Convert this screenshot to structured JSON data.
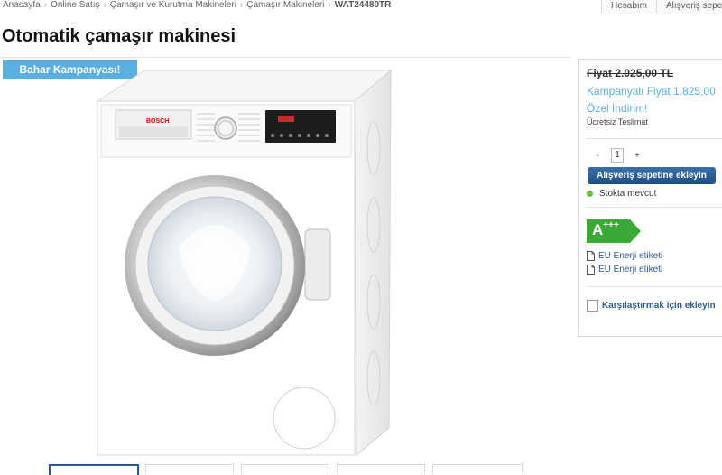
{
  "breadcrumb": {
    "items": [
      "Anasayfa",
      "Online Satış",
      "Çamaşır ve Kurutma Makineleri",
      "Çamaşır Makineleri"
    ],
    "current": "WAT24480TR"
  },
  "top_links": [
    "Hesabım",
    "Alışveriş sepeti"
  ],
  "page": {
    "title": "Otomatik çamaşır makinesi",
    "badge": "Bahar Kampanyası!"
  },
  "product_image": {
    "brand": "BOSCH"
  },
  "sidebar": {
    "old_price": "Fiyat 2.025,00 TL",
    "campaign_price": "Kampanyalı Fiyat 1.825,00",
    "special_discount": "Özel İndirim!",
    "free_delivery": "Ücretsiz Teslimat",
    "qty_minus": "-",
    "qty_value": "1",
    "qty_plus": "+",
    "add_to_cart": "Alışveriş sepetine ekleyin",
    "stock_status": "Stokta mevcut",
    "energy_class": "A",
    "energy_plus": "+++",
    "energy_link_1": "EU Enerji etiketi",
    "energy_link_2": "EU Enerji etiketi",
    "compare": "Karşılaştırmak için ekleyin"
  },
  "colors": {
    "accent_blue": "#5aaee0",
    "button_blue": "#2a5d94",
    "energy_green": "#3aa935",
    "stock_green": "#6cba3c"
  }
}
